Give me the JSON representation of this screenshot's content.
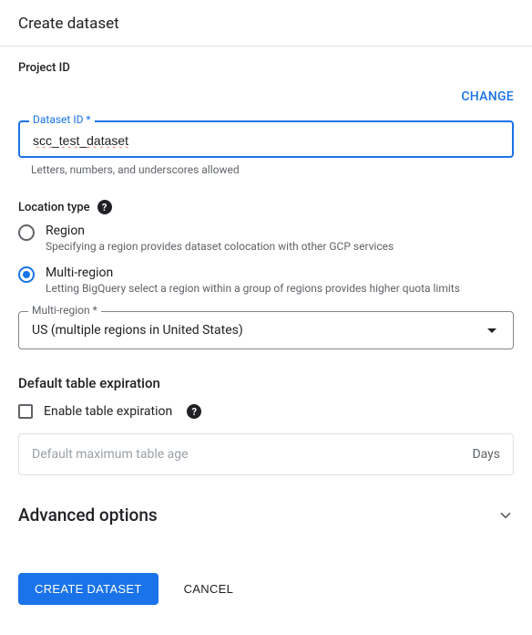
{
  "header": {
    "title": "Create dataset"
  },
  "project": {
    "label": "Project ID",
    "change_label": "CHANGE"
  },
  "dataset_id": {
    "label": "Dataset ID *",
    "value": "scc_test_dataset",
    "helper": "Letters, numbers, and underscores allowed"
  },
  "location": {
    "label": "Location type",
    "options": [
      {
        "label": "Region",
        "desc": "Specifying a region provides dataset colocation with other GCP services",
        "selected": false
      },
      {
        "label": "Multi-region",
        "desc": "Letting BigQuery select a region within a group of regions provides higher quota limits",
        "selected": true
      }
    ],
    "select": {
      "label": "Multi-region *",
      "value": "US (multiple regions in United States)"
    }
  },
  "expiration": {
    "header": "Default table expiration",
    "checkbox_label": "Enable table expiration",
    "placeholder": "Default maximum table age",
    "suffix": "Days"
  },
  "advanced": {
    "title": "Advanced options"
  },
  "actions": {
    "primary": "CREATE DATASET",
    "cancel": "CANCEL"
  }
}
